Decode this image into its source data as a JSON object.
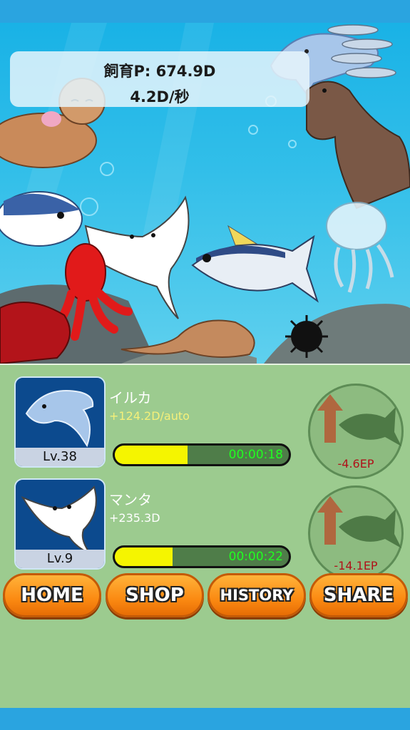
{
  "score": {
    "points_label": "飼育P: 674.9D",
    "rate_label": "4.2D/秒"
  },
  "creatures": [
    {
      "name": "イルカ",
      "rate": "+124.2D/auto",
      "level": "Lv.38",
      "progress": 0.42,
      "timer": "00:00:18",
      "ep": "-4.6EP"
    },
    {
      "name": "マンタ",
      "rate": "+235.3D",
      "level": "Lv.9",
      "progress": 0.33,
      "timer": "00:00:22",
      "ep": "-14.1EP"
    }
  ],
  "nav": {
    "home": "HOME",
    "shop": "SHOP",
    "history": "HISTORY",
    "share": "SHARE"
  },
  "colors": {
    "ocean": "#2fb9e8",
    "panel": "#9ccb8f",
    "button": "#fb8a12",
    "progress_fill": "#f5f500",
    "timer": "#20ff20",
    "ep": "#b0121a"
  },
  "icons": [
    "dolphin-icon",
    "manta-icon",
    "evolve-arrow-icon",
    "fish-silhouette-icon"
  ]
}
